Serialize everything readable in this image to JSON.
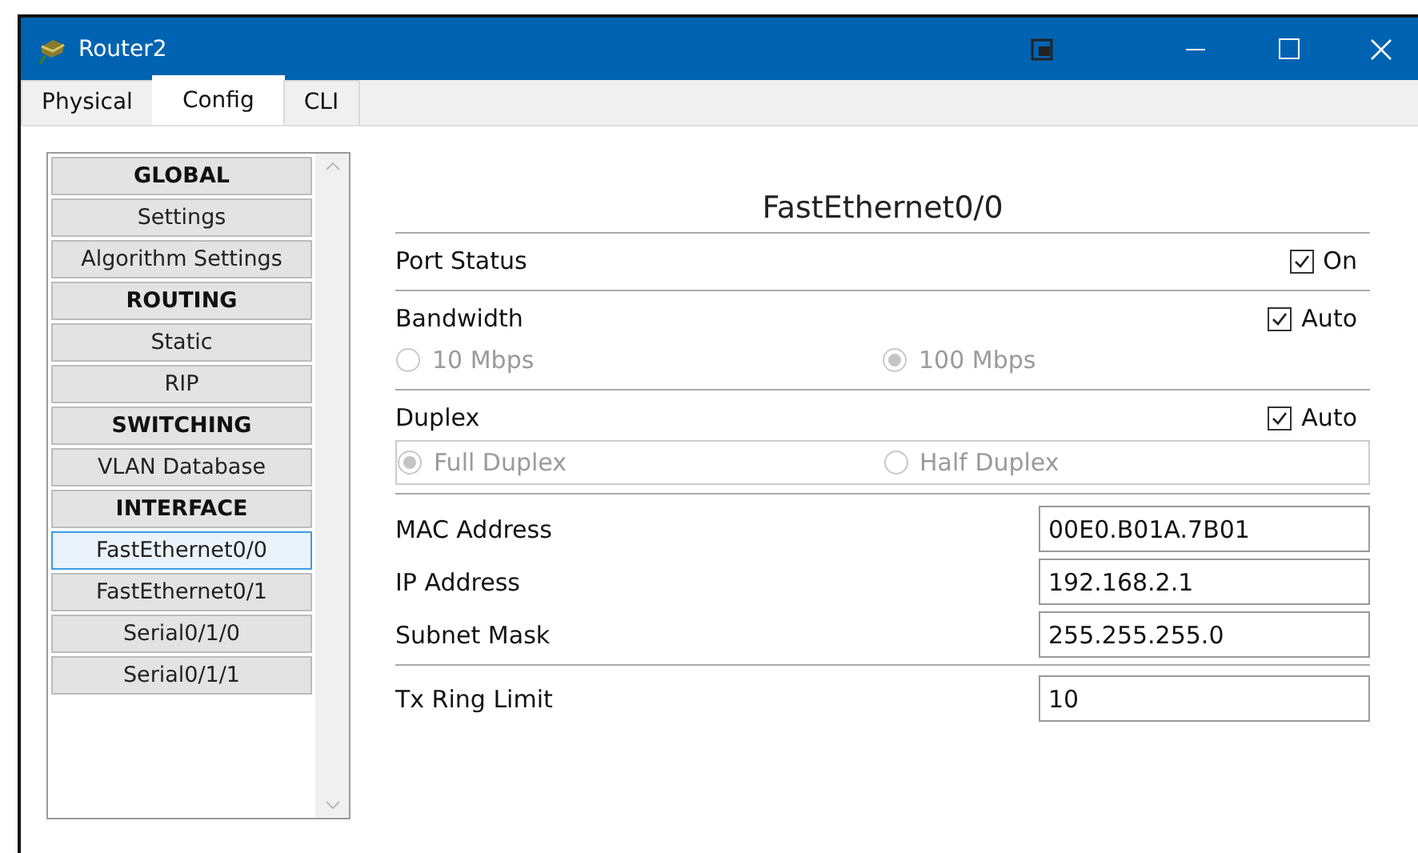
{
  "window": {
    "title": "Router2"
  },
  "tabs": [
    {
      "label": "Physical",
      "selected": false
    },
    {
      "label": "Config",
      "selected": true
    },
    {
      "label": "CLI",
      "selected": false
    }
  ],
  "sidebar": {
    "items": [
      {
        "label": "GLOBAL",
        "kind": "header",
        "selected": false
      },
      {
        "label": "Settings",
        "kind": "item",
        "selected": false
      },
      {
        "label": "Algorithm Settings",
        "kind": "item",
        "selected": false
      },
      {
        "label": "ROUTING",
        "kind": "header",
        "selected": false
      },
      {
        "label": "Static",
        "kind": "item",
        "selected": false
      },
      {
        "label": "RIP",
        "kind": "item",
        "selected": false
      },
      {
        "label": "SWITCHING",
        "kind": "header",
        "selected": false
      },
      {
        "label": "VLAN Database",
        "kind": "item",
        "selected": false
      },
      {
        "label": "INTERFACE",
        "kind": "header",
        "selected": false
      },
      {
        "label": "FastEthernet0/0",
        "kind": "item",
        "selected": true
      },
      {
        "label": "FastEthernet0/1",
        "kind": "item",
        "selected": false
      },
      {
        "label": "Serial0/1/0",
        "kind": "item",
        "selected": false
      },
      {
        "label": "Serial0/1/1",
        "kind": "item",
        "selected": false
      }
    ]
  },
  "panel": {
    "title": "FastEthernet0/0",
    "sections": [
      {
        "label": "Port Status",
        "checkbox": {
          "label": "On",
          "checked": true
        }
      },
      {
        "label": "Bandwidth",
        "checkbox": {
          "label": "Auto",
          "checked": true
        },
        "framed": false,
        "options": [
          {
            "label": "10 Mbps",
            "selected": false,
            "disabled": true
          },
          {
            "label": "100 Mbps",
            "selected": true,
            "disabled": true
          }
        ]
      },
      {
        "label": "Duplex",
        "checkbox": {
          "label": "Auto",
          "checked": true
        },
        "framed": true,
        "options": [
          {
            "label": "Full Duplex",
            "selected": true,
            "disabled": true
          },
          {
            "label": "Half Duplex",
            "selected": false,
            "disabled": true
          }
        ]
      }
    ],
    "field_groups": [
      [
        {
          "label": "MAC Address",
          "value": "00E0.B01A.7B01"
        },
        {
          "label": "IP Address",
          "value": "192.168.2.1"
        },
        {
          "label": "Subnet Mask",
          "value": "255.255.255.0"
        }
      ],
      [
        {
          "label": "Tx Ring Limit",
          "value": "10"
        }
      ]
    ]
  }
}
